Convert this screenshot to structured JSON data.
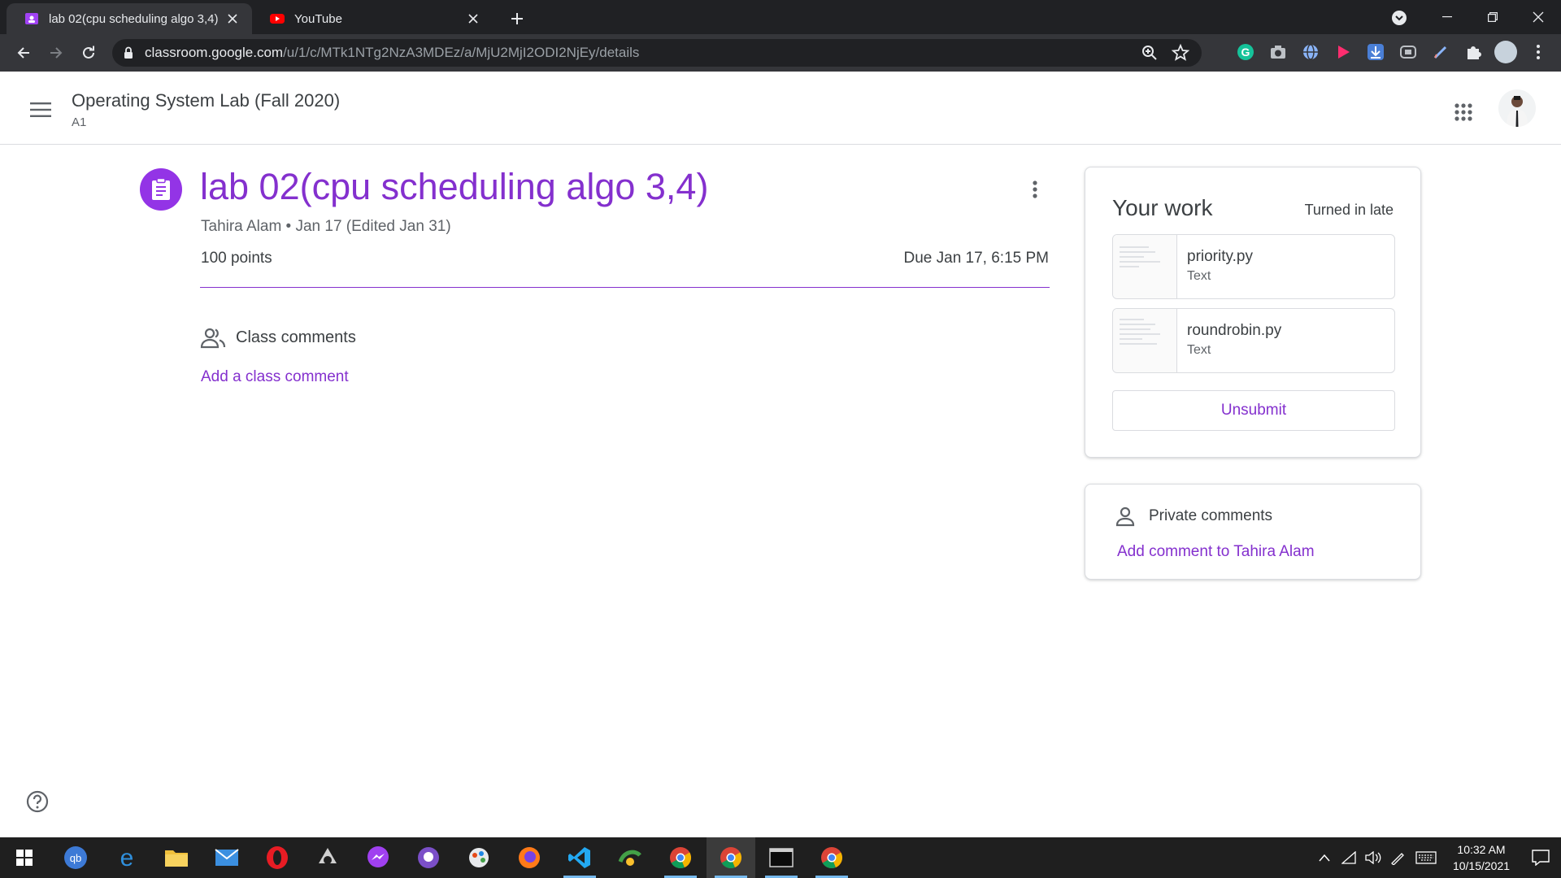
{
  "browser": {
    "tabs": [
      {
        "title": "lab 02(cpu scheduling algo 3,4)",
        "favicon": "google-classroom-icon",
        "active": true
      },
      {
        "title": "YouTube",
        "favicon": "youtube-icon",
        "active": false
      }
    ],
    "url_host": "classroom.google.com",
    "url_path": "/u/1/c/MTk1NTg2NzA3MDEz/a/MjU2MjI2ODI2NjEy/details",
    "extensions": [
      "grammarly-icon",
      "camera-icon",
      "globe-icon",
      "play-icon",
      "download-icon",
      "window-icon",
      "pen-icon",
      "puzzle-icon"
    ]
  },
  "header": {
    "class_title": "Operating System Lab (Fall 2020)",
    "section": "A1"
  },
  "assignment": {
    "title": "lab 02(cpu scheduling algo 3,4)",
    "meta": "Tahira Alam • Jan 17 (Edited Jan 31)",
    "points": "100 points",
    "due": "Due Jan 17, 6:15 PM",
    "class_comments_label": "Class comments",
    "add_class_comment": "Add a class comment"
  },
  "your_work": {
    "title": "Your work",
    "status": "Turned in late",
    "attachments": [
      {
        "name": "priority.py",
        "type": "Text"
      },
      {
        "name": "roundrobin.py",
        "type": "Text"
      }
    ],
    "unsubmit_label": "Unsubmit"
  },
  "private_comments": {
    "label": "Private comments",
    "add_label": "Add comment to Tahira Alam"
  },
  "taskbar": {
    "apps": [
      "windows-start-icon",
      "qbittorrent-icon",
      "edge-icon",
      "file-explorer-icon",
      "mail-icon",
      "opera-icon",
      "inkscape-icon",
      "messenger-icon",
      "github-desktop-icon",
      "paint-icon",
      "firefox-icon",
      "vscode-icon",
      "utility-icon",
      "chrome-icon",
      "chrome-active-icon",
      "terminal-icon",
      "chrome-profile-icon"
    ],
    "time": "10:32 AM",
    "date": "10/15/2021"
  },
  "colors": {
    "accent": "#8430ce",
    "accent_icon_bg": "#9334e6",
    "chrome_dark": "#202124",
    "chrome_toolbar": "#35363a"
  }
}
